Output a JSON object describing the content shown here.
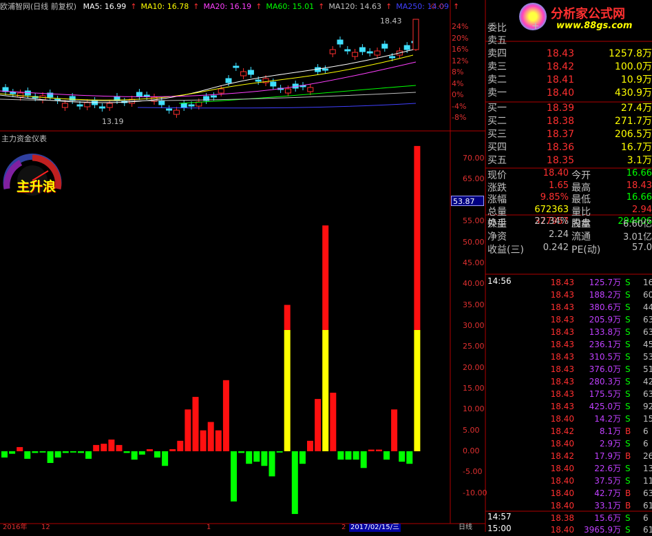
{
  "header": {
    "title": "欧浦智网(日线 前复权)",
    "ma": [
      {
        "label": "MA5: 16.99",
        "color": "#ffffff"
      },
      {
        "label": "MA10: 16.78",
        "color": "#ffff00"
      },
      {
        "label": "MA20: 16.19",
        "color": "#ff40ff"
      },
      {
        "label": "MA60: 15.01",
        "color": "#00ff00"
      },
      {
        "label": "MA120: 14.63",
        "color": "#c0c0c0"
      },
      {
        "label": "MA250: 14.09",
        "color": "#4040ff"
      }
    ],
    "arrow": "↑"
  },
  "price_chart": {
    "high_label": "18.43",
    "low_label": "13.19",
    "pct_axis": [
      "24%",
      "20%",
      "16%",
      "12%",
      "8%",
      "4%",
      "0%",
      "-4%",
      "-8%"
    ]
  },
  "indicator": {
    "title": "主力资金仪表",
    "gauge_label": "主升浪",
    "current_value": "53.87",
    "y_axis": [
      "70.00",
      "65.00",
      "60.00",
      "55.00",
      "50.00",
      "45.00",
      "40.00",
      "35.00",
      "30.00",
      "25.00",
      "20.00",
      "15.00",
      "10.00",
      "5.00",
      "0.00",
      "-5.00",
      "-10.00"
    ]
  },
  "chart_data": {
    "type": "bar",
    "title": "主力资金仪表",
    "ylim": [
      -14,
      75
    ],
    "values": [
      -1.5,
      -0.6,
      1.0,
      -1.8,
      -0.4,
      -0.3,
      -2.8,
      -1.5,
      -0.4,
      -0.3,
      -0.4,
      -1.8,
      1.5,
      1.8,
      2.8,
      1.5,
      -0.4,
      -2.0,
      -0.8,
      0.5,
      -1.5,
      -3.5,
      0.5,
      2.5,
      10.0,
      13.0,
      5.0,
      7.0,
      5.0,
      17.0,
      -12.0,
      -0.4,
      -3.0,
      -2.5,
      -3.5,
      -6.0,
      -0.3,
      35.0,
      -15.0,
      -3.0,
      2.5,
      12.5,
      54.0,
      14.0,
      -2.0,
      -2.0,
      -2.0,
      -4.0,
      0.4,
      0.4,
      -2.0,
      10.0,
      -2.5,
      -3.0,
      73.0
    ],
    "yellow_threshold": 29
  },
  "bottom_bar": {
    "year": "2016年",
    "m12": "12",
    "m1": "1",
    "m2": "2",
    "date": "2017/02/15/三",
    "period": "日线"
  },
  "logo": {
    "name": "分析家公式网",
    "url": "www.88gs.com"
  },
  "quote": {
    "weibi_label": "委比",
    "weibi_value": "+",
    "sell": [
      {
        "label": "卖五",
        "price": "",
        "vol": ""
      },
      {
        "label": "卖四",
        "price": "18.43",
        "vol": "1257.8万"
      },
      {
        "label": "卖三",
        "price": "18.42",
        "vol": "100.0万"
      },
      {
        "label": "卖二",
        "price": "18.41",
        "vol": "10.9万"
      },
      {
        "label": "卖一",
        "price": "18.40",
        "vol": "430.9万"
      }
    ],
    "buy": [
      {
        "label": "买一",
        "price": "18.39",
        "vol": "27.4万"
      },
      {
        "label": "买二",
        "price": "18.38",
        "vol": "271.7万"
      },
      {
        "label": "买三",
        "price": "18.37",
        "vol": "206.5万"
      },
      {
        "label": "买四",
        "price": "18.36",
        "vol": "16.7万"
      },
      {
        "label": "买五",
        "price": "18.35",
        "vol": "3.1万"
      }
    ],
    "stats": [
      {
        "l1": "现价",
        "v1": "18.40",
        "c1": "#ff3030",
        "l2": "今开",
        "v2": "16.66",
        "c2": "#00ff00"
      },
      {
        "l1": "涨跌",
        "v1": "1.65",
        "c1": "#ff3030",
        "l2": "最高",
        "v2": "18.43",
        "c2": "#ff3030"
      },
      {
        "l1": "涨幅",
        "v1": "9.85%",
        "c1": "#ff3030",
        "l2": "最低",
        "v2": "16.66",
        "c2": "#00ff00"
      },
      {
        "l1": "总量",
        "v1": "672363",
        "c1": "#ffff00",
        "l2": "量比",
        "v2": "2.94",
        "c2": "#ff3030"
      },
      {
        "l1": "外盘",
        "v1": "377957",
        "c1": "#ff3030",
        "l2": "内盘",
        "v2": "294406",
        "c2": "#00ff00"
      }
    ],
    "fund": [
      {
        "l1": "换手",
        "v1": "22.34%",
        "l2": "股本",
        "v2": "6.60亿"
      },
      {
        "l1": "净资",
        "v1": "2.24",
        "l2": "流通",
        "v2": "3.01亿"
      },
      {
        "l1": "收益(三)",
        "v1": "0.242",
        "l2": "PE(动)",
        "v2": "57.0"
      }
    ]
  },
  "ticks": {
    "time1": "14:56",
    "time2": "14:57",
    "time3": "15:00",
    "rows": [
      {
        "p": "18.43",
        "v": "125.7万",
        "bs": "S",
        "n": "16"
      },
      {
        "p": "18.43",
        "v": "188.2万",
        "bs": "S",
        "n": "60"
      },
      {
        "p": "18.43",
        "v": "380.6万",
        "bs": "S",
        "n": "44"
      },
      {
        "p": "18.43",
        "v": "205.9万",
        "bs": "S",
        "n": "63"
      },
      {
        "p": "18.43",
        "v": "133.8万",
        "bs": "S",
        "n": "63"
      },
      {
        "p": "18.43",
        "v": "236.1万",
        "bs": "S",
        "n": "45"
      },
      {
        "p": "18.43",
        "v": "310.5万",
        "bs": "S",
        "n": "53"
      },
      {
        "p": "18.43",
        "v": "376.0万",
        "bs": "S",
        "n": "51"
      },
      {
        "p": "18.43",
        "v": "280.3万",
        "bs": "S",
        "n": "42"
      },
      {
        "p": "18.43",
        "v": "175.5万",
        "bs": "S",
        "n": "63"
      },
      {
        "p": "18.43",
        "v": "425.0万",
        "bs": "S",
        "n": "92"
      },
      {
        "p": "18.40",
        "v": "14.2万",
        "bs": "S",
        "n": "15"
      },
      {
        "p": "18.42",
        "v": "8.1万",
        "bs": "B",
        "n": "6"
      },
      {
        "p": "18.40",
        "v": "2.9万",
        "bs": "S",
        "n": "6"
      },
      {
        "p": "18.42",
        "v": "17.9万",
        "bs": "B",
        "n": "26"
      },
      {
        "p": "18.40",
        "v": "22.6万",
        "bs": "S",
        "n": "13"
      },
      {
        "p": "18.40",
        "v": "37.5万",
        "bs": "S",
        "n": "11"
      },
      {
        "p": "18.40",
        "v": "42.7万",
        "bs": "B",
        "n": "63"
      },
      {
        "p": "18.40",
        "v": "33.1万",
        "bs": "B",
        "n": "61"
      }
    ],
    "row_1457": {
      "p": "18.38",
      "v": "15.6万",
      "bs": "S",
      "n": "6"
    },
    "row_1500": {
      "p": "18.40",
      "v": "3965.9万",
      "bs": "S",
      "n": "61"
    }
  }
}
